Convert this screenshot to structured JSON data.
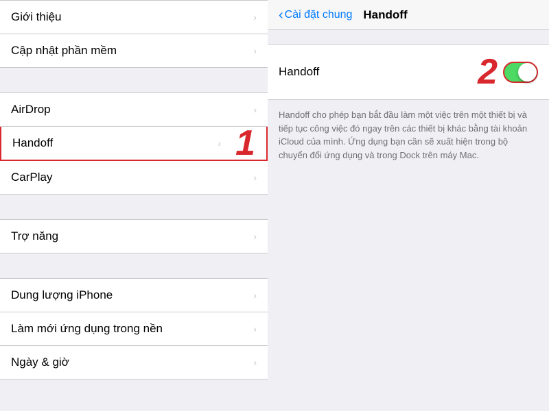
{
  "leftPanel": {
    "items": [
      {
        "id": "gioi-thieu",
        "label": "Giới thiệu",
        "highlighted": false
      },
      {
        "id": "cap-nhat-phan-mem",
        "label": "Cập nhật phần mềm",
        "highlighted": false
      },
      {
        "id": "airdrop",
        "label": "AirDrop",
        "highlighted": false
      },
      {
        "id": "handoff",
        "label": "Handoff",
        "highlighted": true
      },
      {
        "id": "carplay",
        "label": "CarPlay",
        "highlighted": false
      },
      {
        "id": "tro-nang",
        "label": "Trợ năng",
        "highlighted": false
      },
      {
        "id": "dung-luong",
        "label": "Dung lượng iPhone",
        "highlighted": false
      },
      {
        "id": "lam-moi",
        "label": "Làm mới ứng dụng trong nền",
        "highlighted": false
      },
      {
        "id": "ngay-gio",
        "label": "Ngày & giờ",
        "highlighted": false
      }
    ]
  },
  "rightPanel": {
    "backLabel": "Cài đặt chung",
    "title": "Handoff",
    "toggleLabel": "Handoff",
    "toggleOn": true,
    "description": "Handoff cho phép bạn bắt đầu làm một việc trên một thiết bị và tiếp tục công việc đó ngay trên các thiết bị khác bằng tài khoản iCloud của mình. Ứng dụng bạn cần sẽ xuất hiện trong bộ chuyển đổi ứng dụng và trong Dock trên máy Mac."
  },
  "annotations": {
    "one": "1",
    "two": "2"
  }
}
